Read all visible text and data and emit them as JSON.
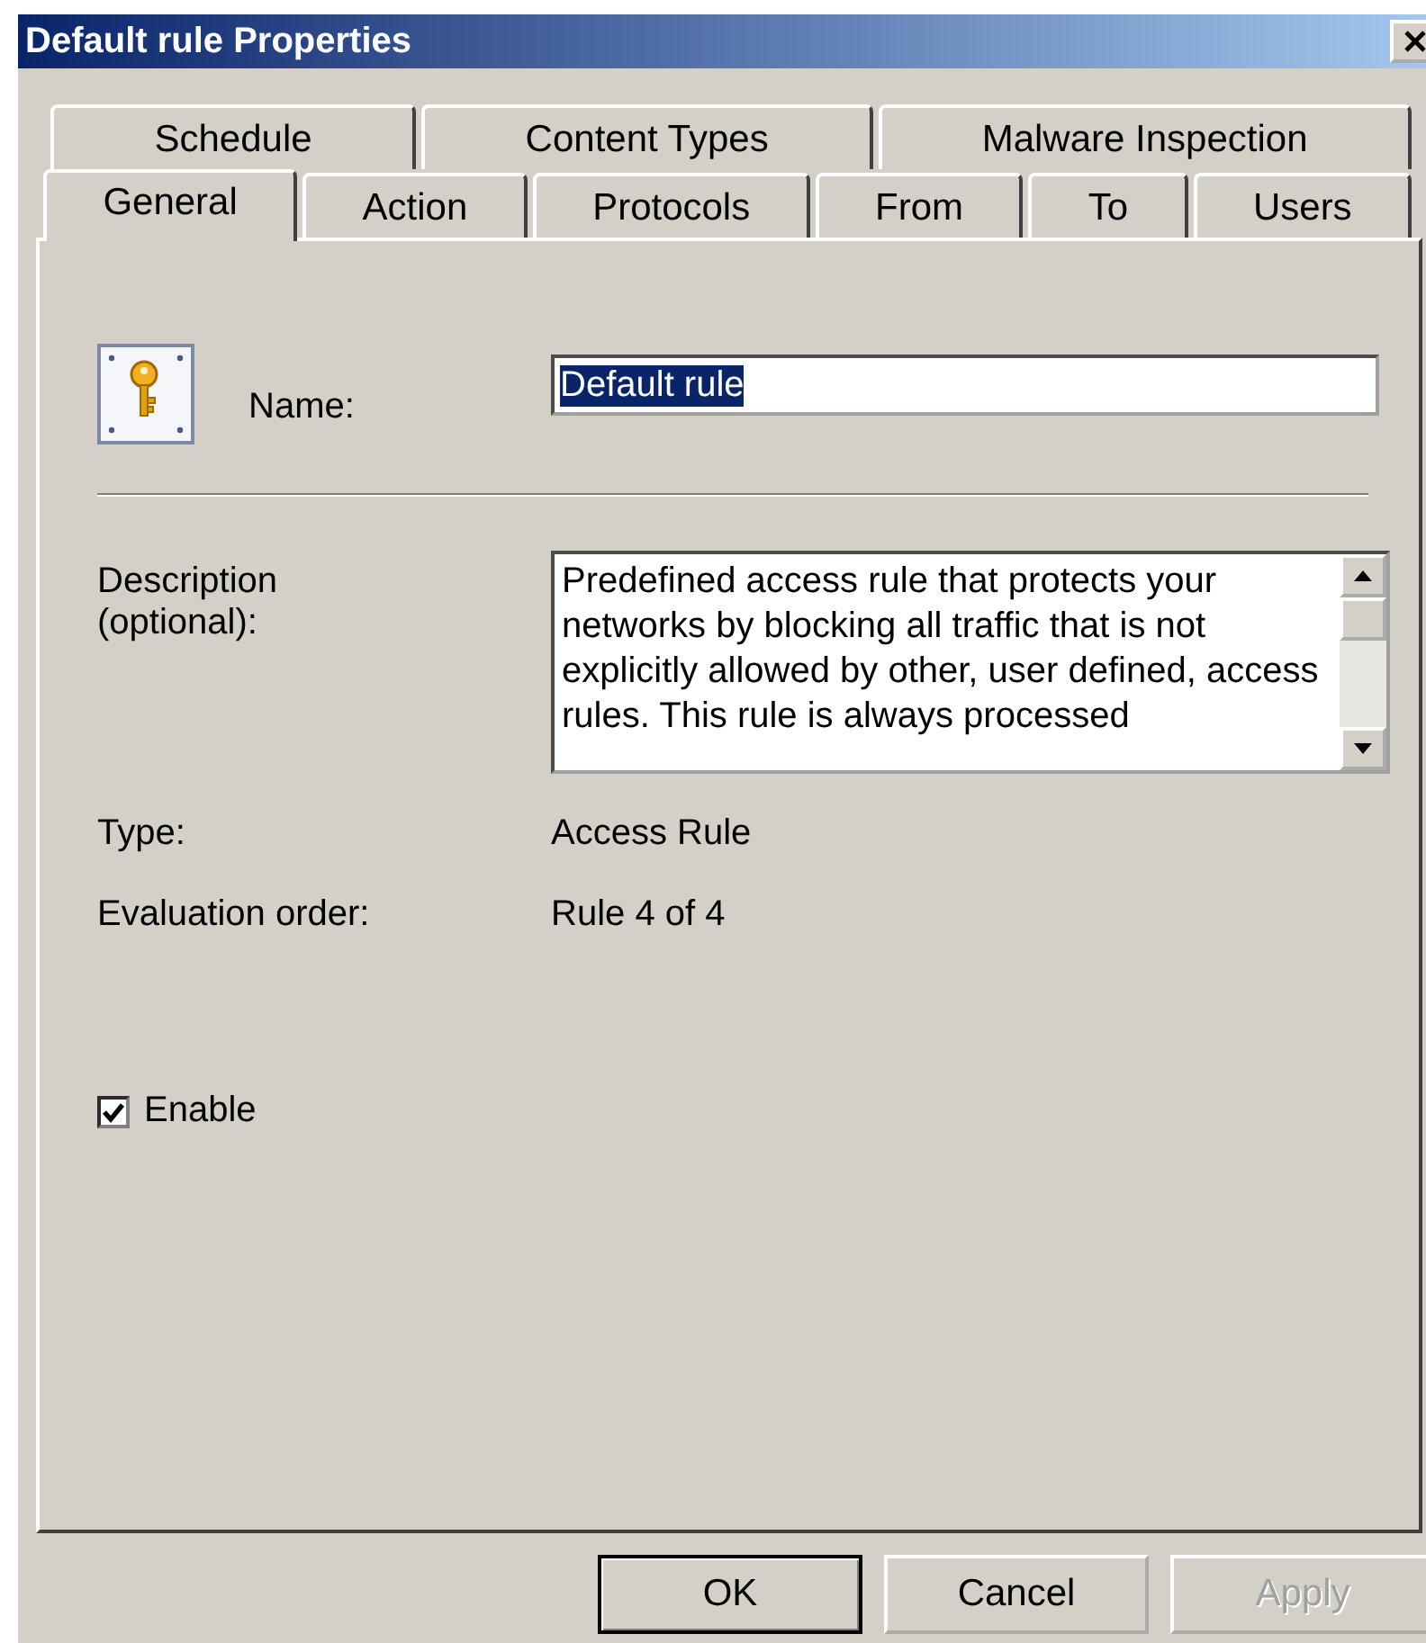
{
  "window": {
    "title": "Default rule Properties"
  },
  "tab_rows": [
    {
      "tabs": [
        {
          "label": "Schedule",
          "selected": false
        },
        {
          "label": "Content Types",
          "selected": false
        },
        {
          "label": "Malware Inspection",
          "selected": false
        }
      ]
    },
    {
      "tabs": [
        {
          "label": "General",
          "selected": true
        },
        {
          "label": "Action",
          "selected": false
        },
        {
          "label": "Protocols",
          "selected": false
        },
        {
          "label": "From",
          "selected": false
        },
        {
          "label": "To",
          "selected": false
        },
        {
          "label": "Users",
          "selected": false
        }
      ]
    }
  ],
  "name": {
    "label": "Name:",
    "value": "Default rule",
    "highlighted": true
  },
  "description": {
    "label": "Description (optional):",
    "value": "Predefined access rule that protects your networks by blocking all traffic that is not explicitly allowed by other, user defined, access rules. This rule is always processed"
  },
  "properties": [
    {
      "label": "Type:",
      "value": "Access Rule"
    },
    {
      "label": "Evaluation order:",
      "value": "Rule 4 of 4"
    }
  ],
  "enable": {
    "label": "Enable",
    "checked": true
  },
  "buttons": [
    {
      "label": "OK",
      "default": true,
      "disabled": false
    },
    {
      "label": "Cancel",
      "default": false,
      "disabled": false
    },
    {
      "label": "Apply",
      "default": false,
      "disabled": true
    }
  ]
}
